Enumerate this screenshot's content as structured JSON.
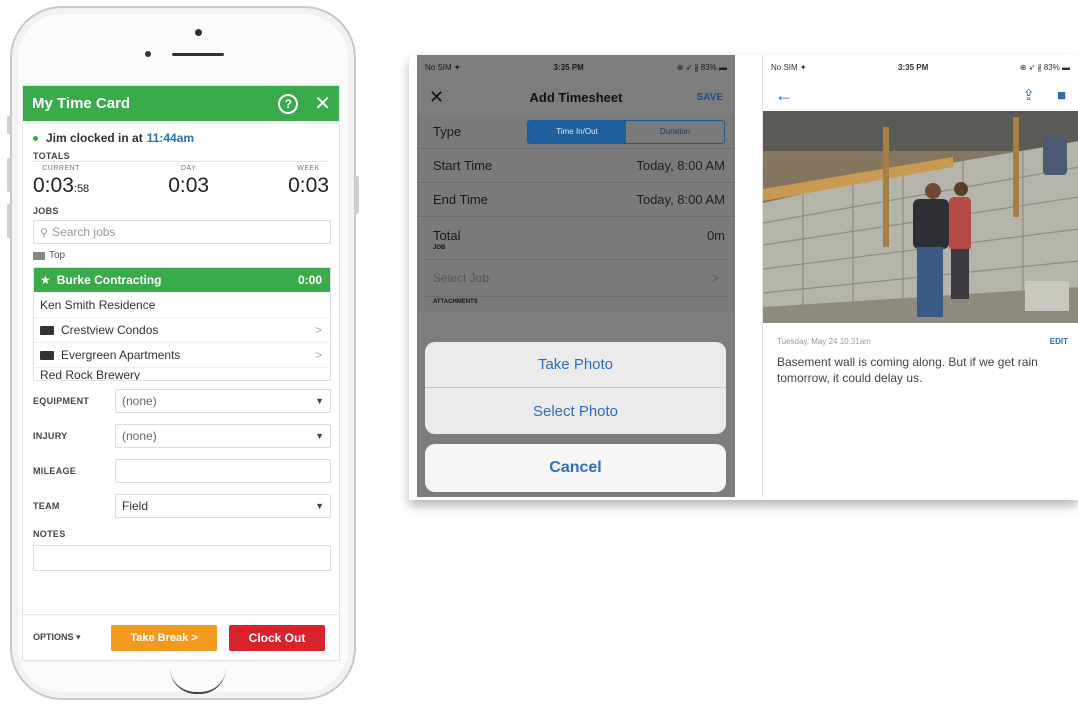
{
  "timecard": {
    "title": "My Time Card",
    "help_icon": "?",
    "close_icon": "✕",
    "clock_status": "Jim clocked in at",
    "clock_time": "11:44am",
    "totals_label": "TOTALS",
    "totals": [
      {
        "label": "CURRENT",
        "value": "0:03",
        "seconds": "58"
      },
      {
        "label": "DAY",
        "value": "0:03"
      },
      {
        "label": "WEEK",
        "value": "0:03"
      }
    ],
    "jobs_label": "JOBS",
    "search_placeholder": "Search jobs",
    "top_crumb": "Top",
    "jobs": [
      {
        "name": "Burke Contracting",
        "time": "0:00",
        "active": true
      },
      {
        "name": "Ken Smith Residence"
      },
      {
        "name": "Crestview Condos",
        "folder": true
      },
      {
        "name": "Evergreen Apartments",
        "folder": true
      },
      {
        "name": "Red Rock Brewery"
      }
    ],
    "fields": {
      "equipment_label": "EQUIPMENT",
      "equipment_value": "(none)",
      "injury_label": "INJURY",
      "injury_value": "(none)",
      "mileage_label": "MILEAGE",
      "mileage_value": "",
      "team_label": "TEAM",
      "team_value": "Field",
      "notes_label": "NOTES"
    },
    "options_label": "OPTIONS ▾",
    "take_break_label": "Take Break >",
    "clock_out_label": "Clock Out",
    "colors": {
      "header": "#3aab4b",
      "break": "#f39a1e",
      "clock_out": "#d9232b"
    }
  },
  "add_timesheet": {
    "status_carrier": "No SIM ✦",
    "status_time": "3:35 PM",
    "status_battery": "⊕ ➶ ∦ 83% ▬",
    "title": "Add Timesheet",
    "close_icon": "✕",
    "save_label": "SAVE",
    "type_label": "Type",
    "type_options": [
      "Time In/Out",
      "Duration"
    ],
    "start_label": "Start Time",
    "start_value": "Today, 8:00 AM",
    "end_label": "End Time",
    "end_value": "Today, 8:00 AM",
    "total_label": "Total",
    "total_value": "0m",
    "job_caption": "JOB",
    "select_job": "Select Job",
    "attachments_caption": "ATTACHMENTS",
    "take_photo": "Take Photo",
    "select_photo": "Select Photo",
    "cancel": "Cancel"
  },
  "photo_view": {
    "status_carrier": "No SIM ✦",
    "status_time": "3:35 PM",
    "status_battery": "⊕ ➶ ∦ 83% ▬",
    "back_icon": "←",
    "date": "Tuesday, May 24 10:31am",
    "edit_label": "EDIT",
    "note": "Basement wall is coming along. But if we get rain tomorrow, it could delay us."
  }
}
